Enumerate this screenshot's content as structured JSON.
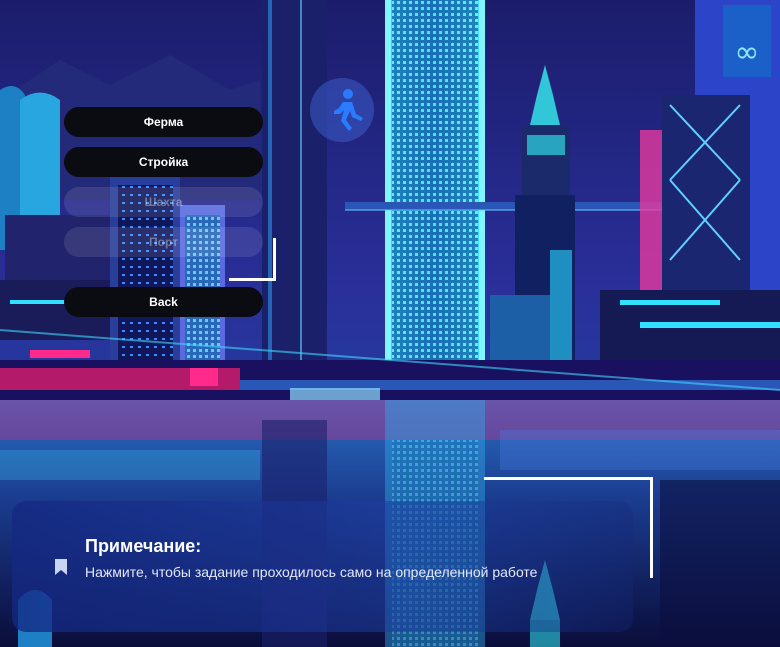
{
  "menu": {
    "items": [
      {
        "label": "Ферма",
        "enabled": true
      },
      {
        "label": "Стройка",
        "enabled": true
      },
      {
        "label": "Шахта",
        "enabled": false
      },
      {
        "label": "Порт",
        "enabled": false
      }
    ],
    "back_label": "Back"
  },
  "note": {
    "title": "Примечание:",
    "text": "Нажмите, чтобы задание проходилось само на определенной работе",
    "icon": "bookmark-icon"
  },
  "background": {
    "description_icon": "running-person-icon",
    "colors": {
      "sky": "#1a1f6e",
      "neon_cyan": "#2fe0ff",
      "neon_pink": "#ff2a8c",
      "deep": "#0a0d3a"
    }
  }
}
